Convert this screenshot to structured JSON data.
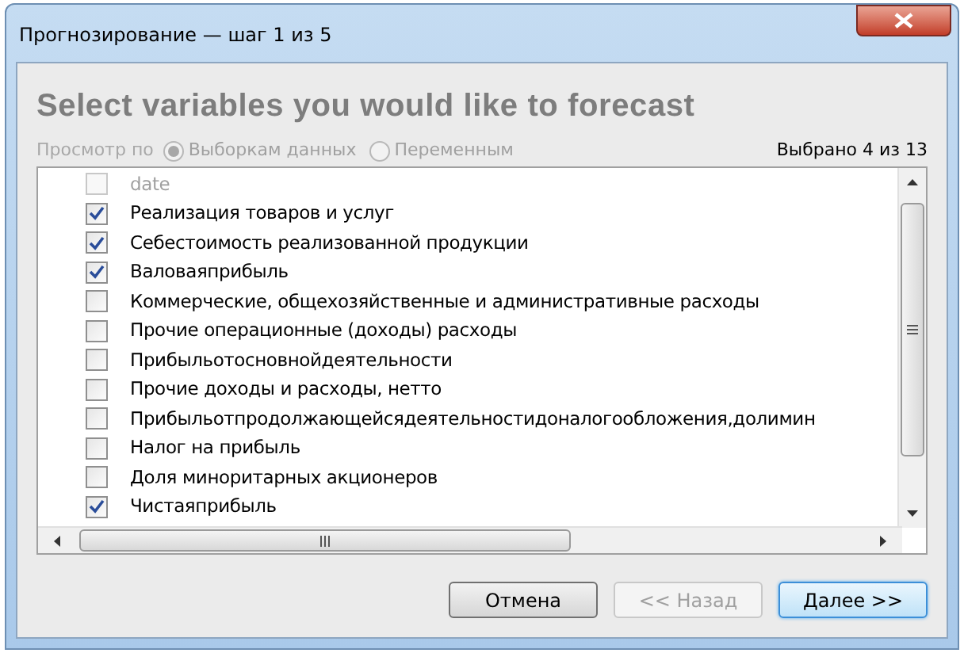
{
  "window": {
    "title": "Прогнозирование — шаг 1 из 5"
  },
  "heading": "Select variables you would like to forecast",
  "view_by": {
    "label": "Просмотр по",
    "options": [
      {
        "label": "Выборкам данных",
        "selected": true,
        "disabled": true
      },
      {
        "label": "Переменным",
        "selected": false,
        "disabled": true
      }
    ]
  },
  "selected_count": "Выбрано 4 из 13",
  "variables": [
    {
      "label": "date",
      "checked": false,
      "disabled": true
    },
    {
      "label": "Реализация товаров и услуг",
      "checked": true,
      "disabled": false
    },
    {
      "label": "Себестоимость реализованной продукции",
      "checked": true,
      "disabled": false
    },
    {
      "label": "Валоваяприбыль",
      "checked": true,
      "disabled": false
    },
    {
      "label": "Коммерческие, общехозяйственные и административные расходы",
      "checked": false,
      "disabled": false
    },
    {
      "label": "Прочие операционные (доходы) расходы",
      "checked": false,
      "disabled": false
    },
    {
      "label": "Прибыльотосновнойдеятельности",
      "checked": false,
      "disabled": false
    },
    {
      "label": "Прочие доходы и расходы, нетто",
      "checked": false,
      "disabled": false
    },
    {
      "label": "Прибыльотпродолжающейсядеятельностидоналогообложения,долимин",
      "checked": false,
      "disabled": false
    },
    {
      "label": "Налог на прибыль",
      "checked": false,
      "disabled": false
    },
    {
      "label": "Доля миноритарных акционеров",
      "checked": false,
      "disabled": false
    },
    {
      "label": "Чистаяприбыль",
      "checked": true,
      "disabled": false
    }
  ],
  "buttons": [
    {
      "label": "Отмена",
      "disabled": false,
      "default": false
    },
    {
      "label": "<< Назад",
      "disabled": true,
      "default": false
    },
    {
      "label": "Далее >>",
      "disabled": false,
      "default": true
    }
  ]
}
